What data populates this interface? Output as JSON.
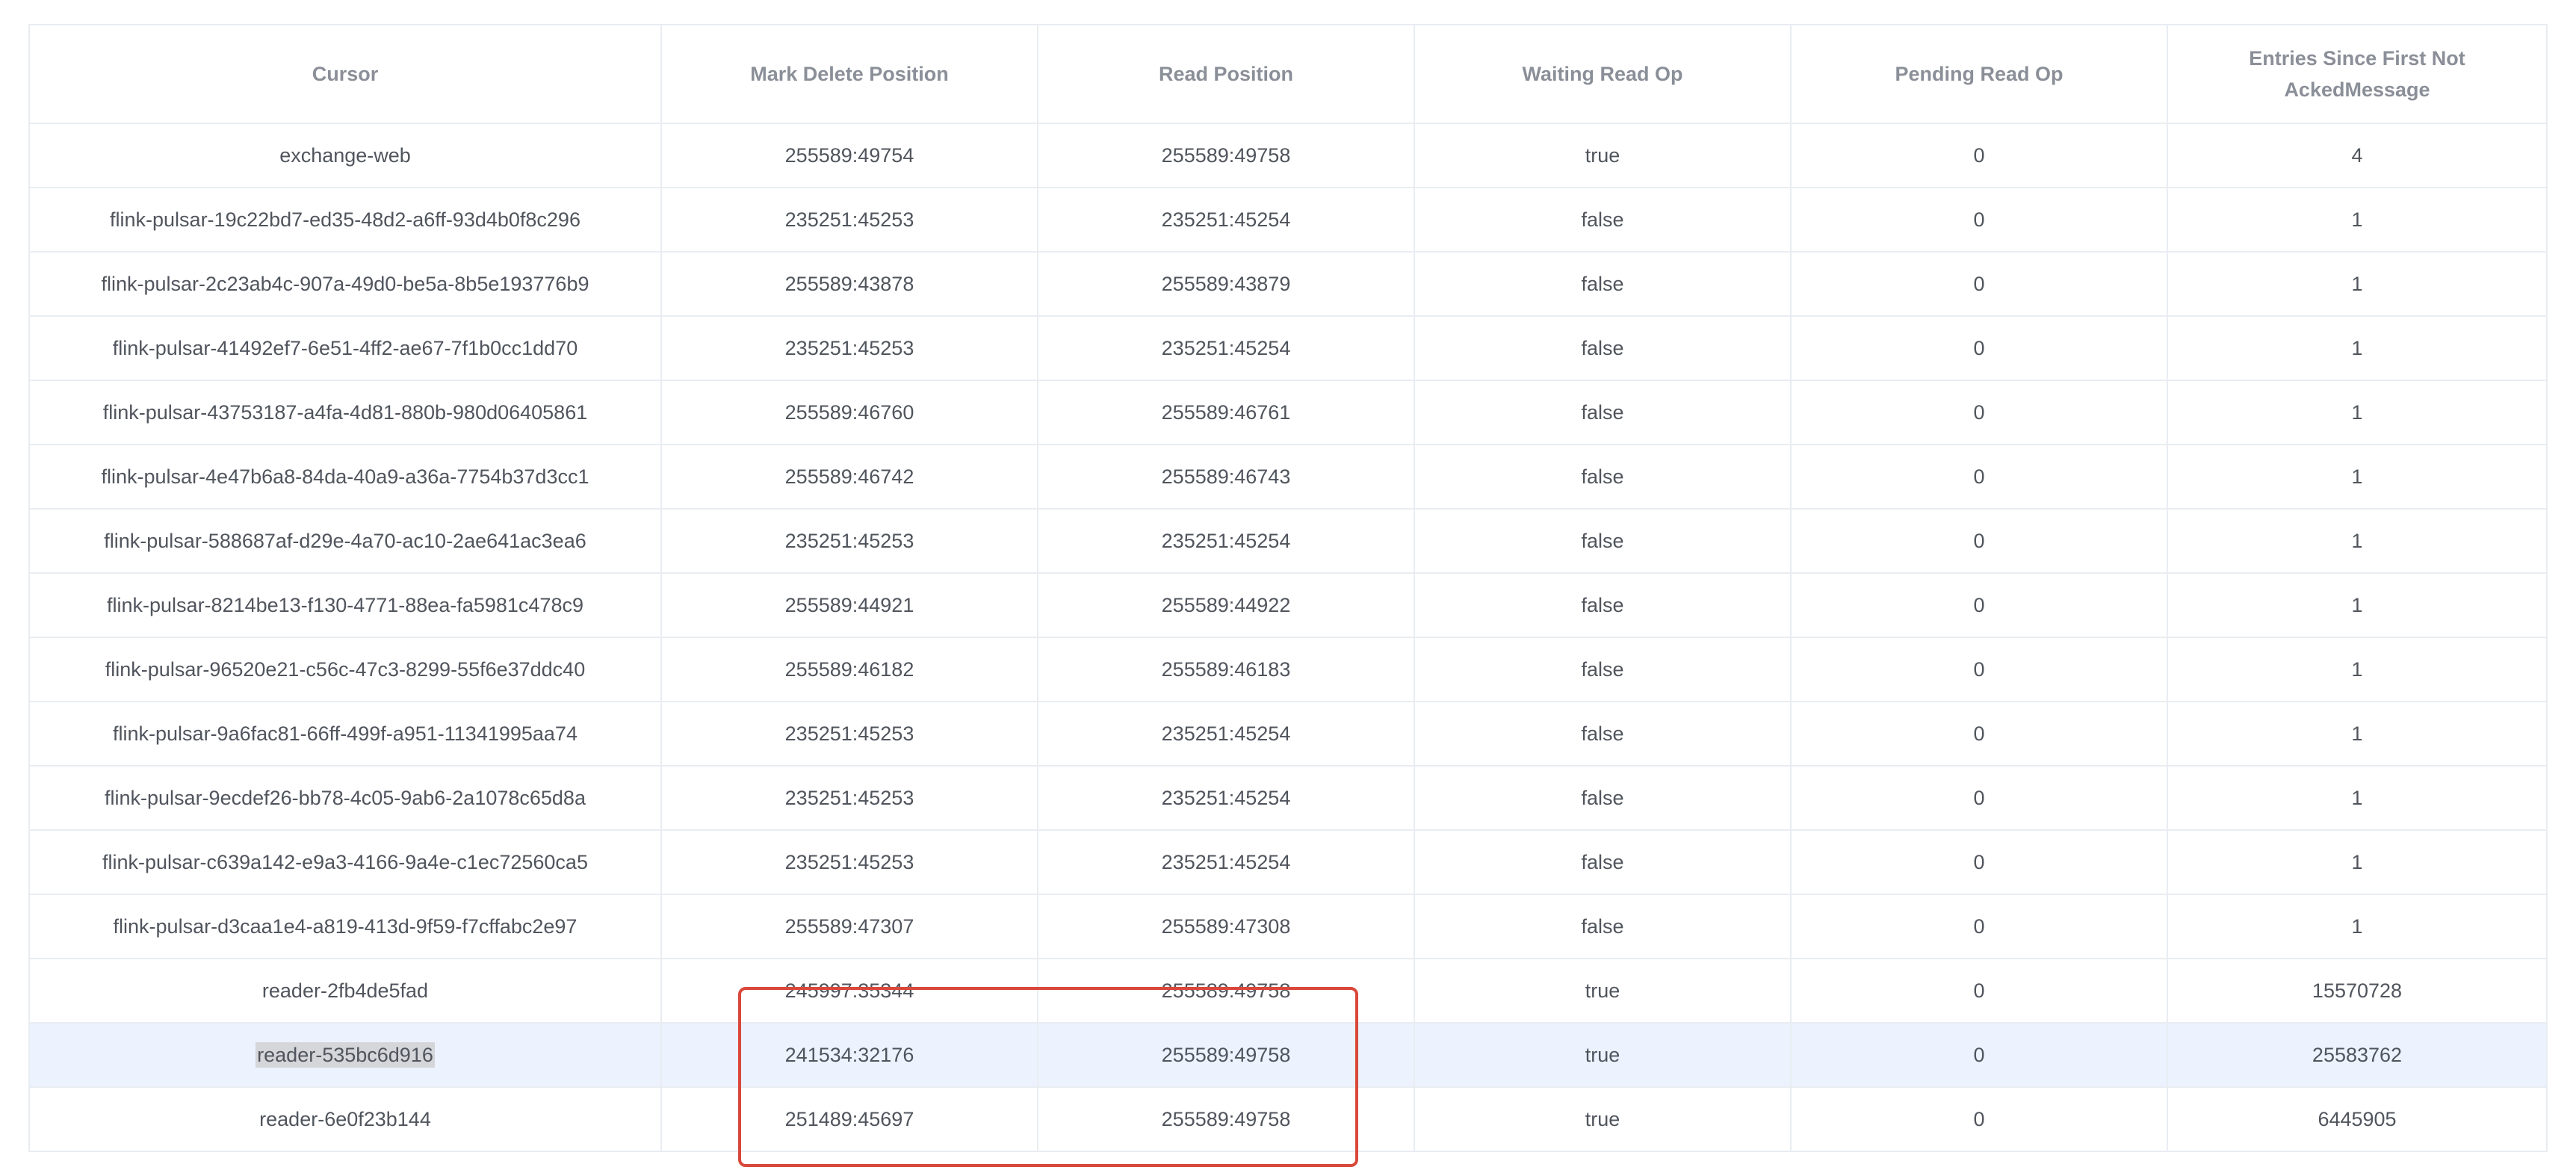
{
  "table": {
    "columns": [
      "Cursor",
      "Mark Delete Position",
      "Read Position",
      "Waiting Read Op",
      "Pending Read Op",
      "Entries Since First Not AckedMessage"
    ],
    "rows": [
      [
        "exchange-web",
        "255589:49754",
        "255589:49758",
        "true",
        "0",
        "4"
      ],
      [
        "flink-pulsar-19c22bd7-ed35-48d2-a6ff-93d4b0f8c296",
        "235251:45253",
        "235251:45254",
        "false",
        "0",
        "1"
      ],
      [
        "flink-pulsar-2c23ab4c-907a-49d0-be5a-8b5e193776b9",
        "255589:43878",
        "255589:43879",
        "false",
        "0",
        "1"
      ],
      [
        "flink-pulsar-41492ef7-6e51-4ff2-ae67-7f1b0cc1dd70",
        "235251:45253",
        "235251:45254",
        "false",
        "0",
        "1"
      ],
      [
        "flink-pulsar-43753187-a4fa-4d81-880b-980d06405861",
        "255589:46760",
        "255589:46761",
        "false",
        "0",
        "1"
      ],
      [
        "flink-pulsar-4e47b6a8-84da-40a9-a36a-7754b37d3cc1",
        "255589:46742",
        "255589:46743",
        "false",
        "0",
        "1"
      ],
      [
        "flink-pulsar-588687af-d29e-4a70-ac10-2ae641ac3ea6",
        "235251:45253",
        "235251:45254",
        "false",
        "0",
        "1"
      ],
      [
        "flink-pulsar-8214be13-f130-4771-88ea-fa5981c478c9",
        "255589:44921",
        "255589:44922",
        "false",
        "0",
        "1"
      ],
      [
        "flink-pulsar-96520e21-c56c-47c3-8299-55f6e37ddc40",
        "255589:46182",
        "255589:46183",
        "false",
        "0",
        "1"
      ],
      [
        "flink-pulsar-9a6fac81-66ff-499f-a951-11341995aa74",
        "235251:45253",
        "235251:45254",
        "false",
        "0",
        "1"
      ],
      [
        "flink-pulsar-9ecdef26-bb78-4c05-9ab6-2a1078c65d8a",
        "235251:45253",
        "235251:45254",
        "false",
        "0",
        "1"
      ],
      [
        "flink-pulsar-c639a142-e9a3-4166-9a4e-c1ec72560ca5",
        "235251:45253",
        "235251:45254",
        "false",
        "0",
        "1"
      ],
      [
        "flink-pulsar-d3caa1e4-a819-413d-9f59-f7cffabc2e97",
        "255589:47307",
        "255589:47308",
        "false",
        "0",
        "1"
      ],
      [
        "reader-2fb4de5fad",
        "245997:35344",
        "255589:49758",
        "true",
        "0",
        "15570728"
      ],
      [
        "reader-535bc6d916",
        "241534:32176",
        "255589:49758",
        "true",
        "0",
        "25583762"
      ],
      [
        "reader-6e0f23b144",
        "251489:45697",
        "255589:49758",
        "true",
        "0",
        "6445905"
      ]
    ]
  },
  "colors": {
    "border": "#e9edf2",
    "header_text": "#8a8f98",
    "selected_row_bg": "#ecf3ff",
    "highlight_box": "#d9483a"
  }
}
